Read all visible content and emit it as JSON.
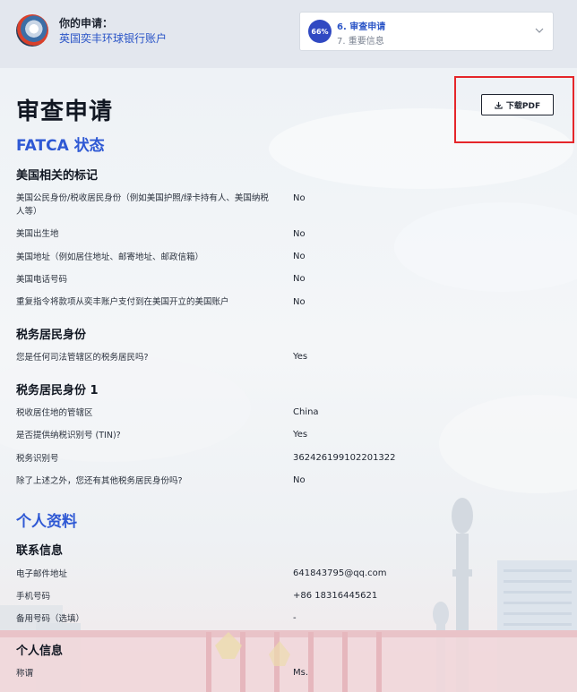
{
  "header": {
    "label": "你的申请：",
    "app_name": "英国奕丰环球银行账户",
    "progress": {
      "percent_label": "66%",
      "current_step": "6. 审查申请",
      "next_step": "7. 重要信息"
    }
  },
  "page": {
    "title": "审查申请",
    "download_label": "下载PDF"
  },
  "fatca": {
    "title": "FATCA 状态",
    "us_indicators": {
      "title": "美国相关的标记",
      "rows": [
        {
          "label": "美国公民身份/税收居民身份（例如美国护照/绿卡持有人、美国纳税人等）",
          "value": "No"
        },
        {
          "label": "美国出生地",
          "value": "No"
        },
        {
          "label": "美国地址（例如居住地址、邮寄地址、邮政信箱）",
          "value": "No"
        },
        {
          "label": "美国电话号码",
          "value": "No"
        },
        {
          "label": "重复指令将款项从奕丰账户支付到在美国开立的美国账户",
          "value": "No"
        }
      ]
    },
    "tax_residency": {
      "title": "税务居民身份",
      "rows": [
        {
          "label": "您是任何司法管辖区的税务居民吗?",
          "value": "Yes"
        }
      ]
    },
    "tax_residency_1": {
      "title": "税务居民身份 1",
      "rows": [
        {
          "label": "税收居住地的管辖区",
          "value": "China"
        },
        {
          "label": "是否提供纳税识别号 (TIN)?",
          "value": "Yes"
        },
        {
          "label": "税务识别号",
          "value": "362426199102201322"
        },
        {
          "label": "除了上述之外，您还有其他税务居民身份吗?",
          "value": "No"
        }
      ]
    }
  },
  "personal": {
    "title": "个人资料",
    "contact": {
      "title": "联系信息",
      "rows": [
        {
          "label": "电子邮件地址",
          "value": "641843795@qq.com"
        },
        {
          "label": "手机号码",
          "value": "+86 18316445621"
        },
        {
          "label": "备用号码（选填）",
          "value": "-"
        }
      ]
    },
    "info": {
      "title": "个人信息",
      "rows": [
        {
          "label": "称谓",
          "value": "Ms."
        }
      ]
    }
  },
  "colors": {
    "accent": "#2f59d4",
    "progress": "#3049c2",
    "highlight": "#e5262a"
  }
}
